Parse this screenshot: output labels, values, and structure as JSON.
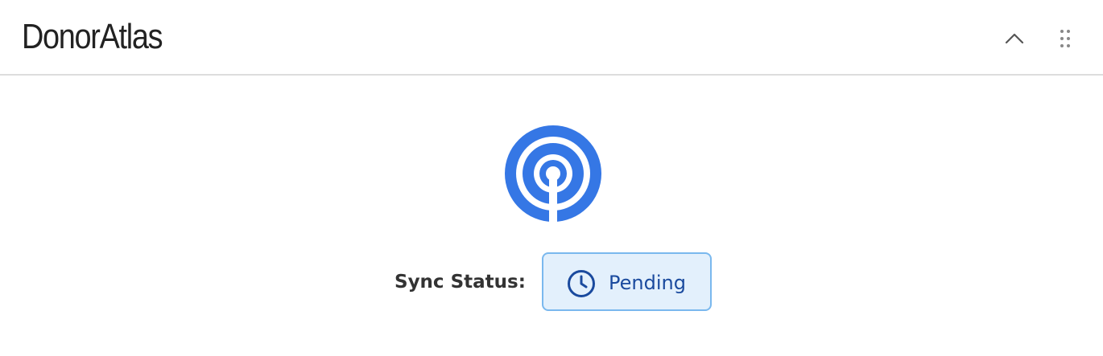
{
  "header": {
    "title": "DonorAtlas",
    "collapse_icon": "chevron-up-icon",
    "drag_icon": "drag-handle-icon"
  },
  "logo": {
    "icon": "signal-broadcast-icon",
    "color": "#3577e5"
  },
  "sync": {
    "label": "Sync Status:",
    "status": "Pending",
    "status_icon": "clock-icon",
    "badge_background": "#e3f0fc",
    "badge_border": "#7ab8ee",
    "text_color": "#1a4a9e"
  }
}
